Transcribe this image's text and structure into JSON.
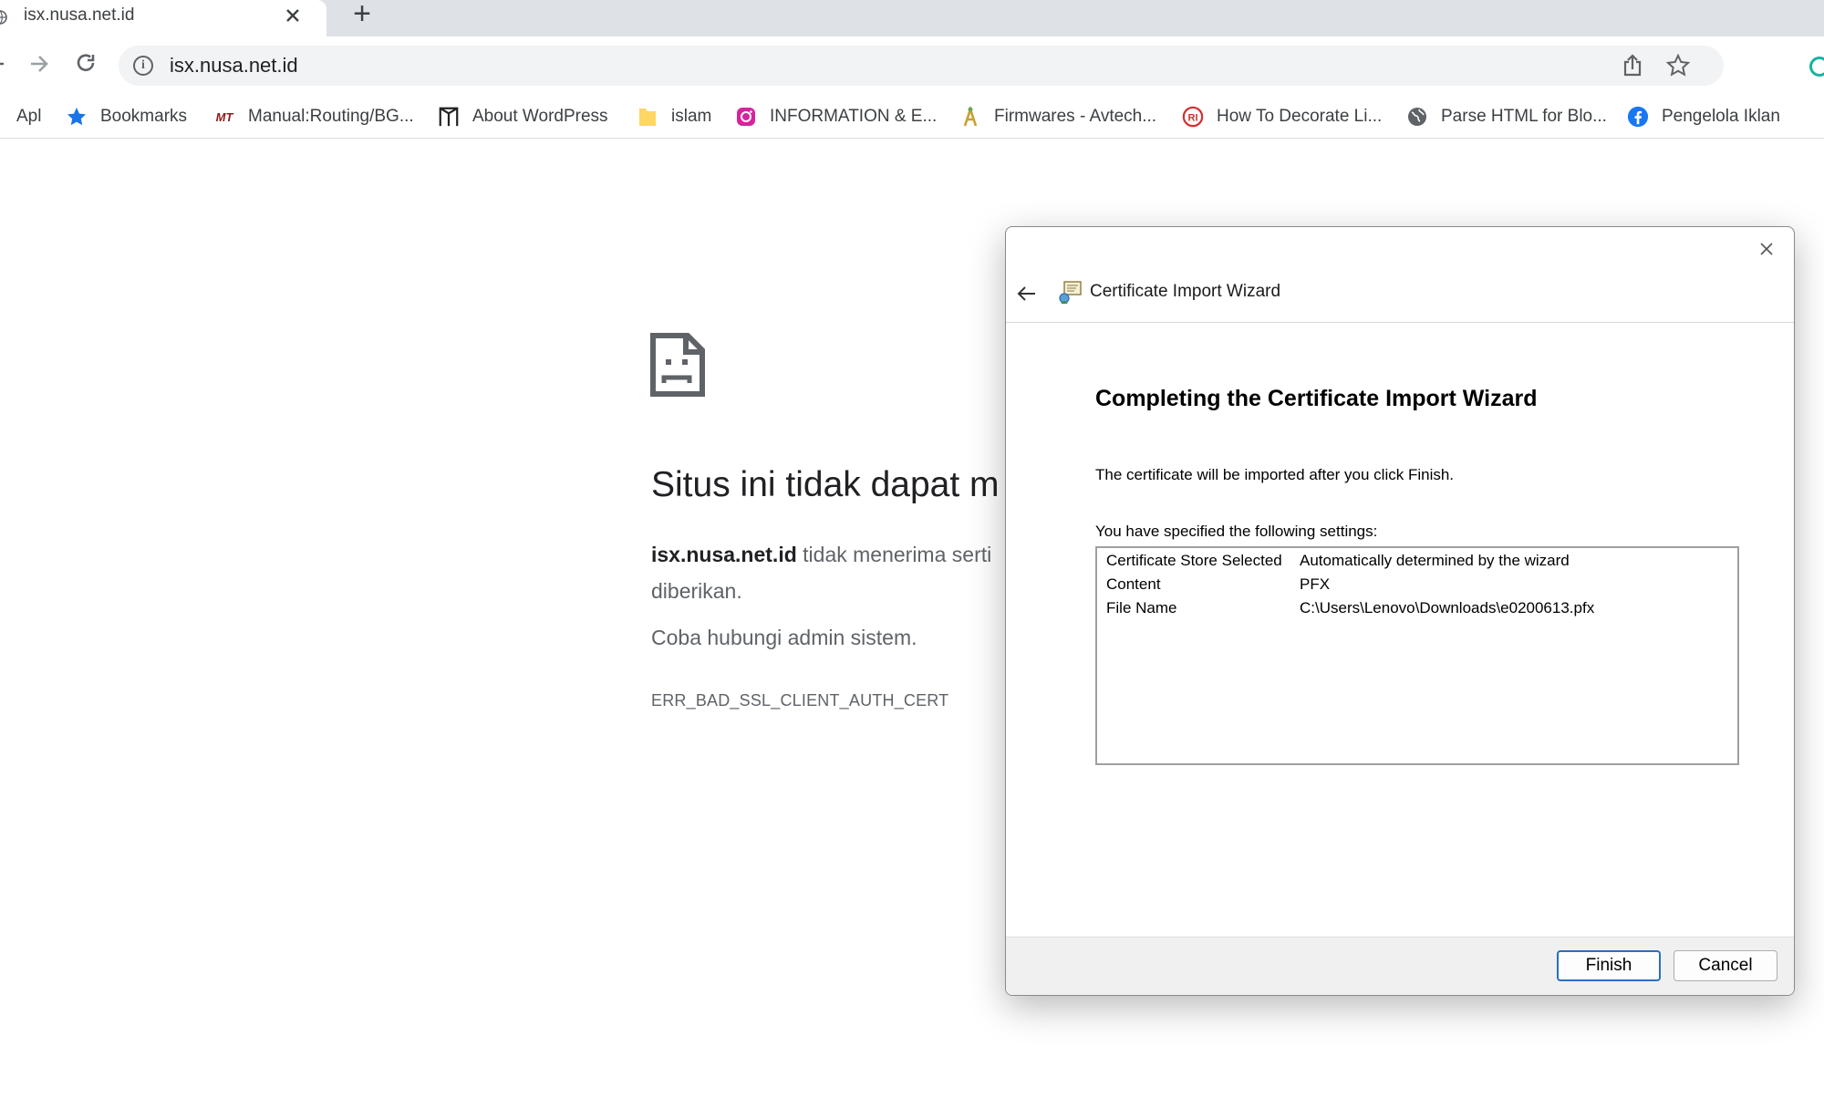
{
  "browser": {
    "tab": {
      "title": "isx.nusa.net.id",
      "close_glyph": "✕"
    },
    "new_tab_glyph": "+",
    "url": "isx.nusa.net.id",
    "bookmarks": [
      {
        "label": "Apl",
        "icon": "apps-grid-icon"
      },
      {
        "label": "Bookmarks",
        "icon": "star-icon"
      },
      {
        "label": "Manual:Routing/BG...",
        "icon": "mikrotik-icon"
      },
      {
        "label": "About WordPress",
        "icon": "wordpress-icon"
      },
      {
        "label": "islam",
        "icon": "folder-icon"
      },
      {
        "label": "INFORMATION & E...",
        "icon": "instagram-icon"
      },
      {
        "label": "Firmwares - Avtech...",
        "icon": "avtech-icon"
      },
      {
        "label": "How To Decorate Li...",
        "icon": "ri-icon"
      },
      {
        "label": "Parse HTML for Blo...",
        "icon": "globe-icon"
      },
      {
        "label": "Pengelola Iklan",
        "icon": "facebook-icon"
      }
    ]
  },
  "error_page": {
    "title": "Situs ini tidak dapat m",
    "host": "isx.nusa.net.id",
    "body_rest": " tidak menerima serti",
    "body_line2": "diberikan.",
    "hint": "Coba hubungi admin sistem.",
    "code": "ERR_BAD_SSL_CLIENT_AUTH_CERT"
  },
  "dialog": {
    "window_title": "Certificate Import Wizard",
    "heading": "Completing the Certificate Import Wizard",
    "description": "The certificate will be imported after you click Finish.",
    "settings_label": "You have specified the following settings:",
    "settings": [
      {
        "key": "Certificate Store Selected",
        "value": "Automatically determined by the wizard"
      },
      {
        "key": "Content",
        "value": "PFX"
      },
      {
        "key": "File Name",
        "value": "C:\\Users\\Lenovo\\Downloads\\e0200613.pfx"
      }
    ],
    "finish_label": "Finish",
    "cancel_label": "Cancel"
  },
  "colors": {
    "tabbar_bg": "#dee1e6",
    "omnibox_bg": "#f1f3f4",
    "finish_border": "#2a6fbf",
    "bookmark_star": "#1a73e8"
  }
}
